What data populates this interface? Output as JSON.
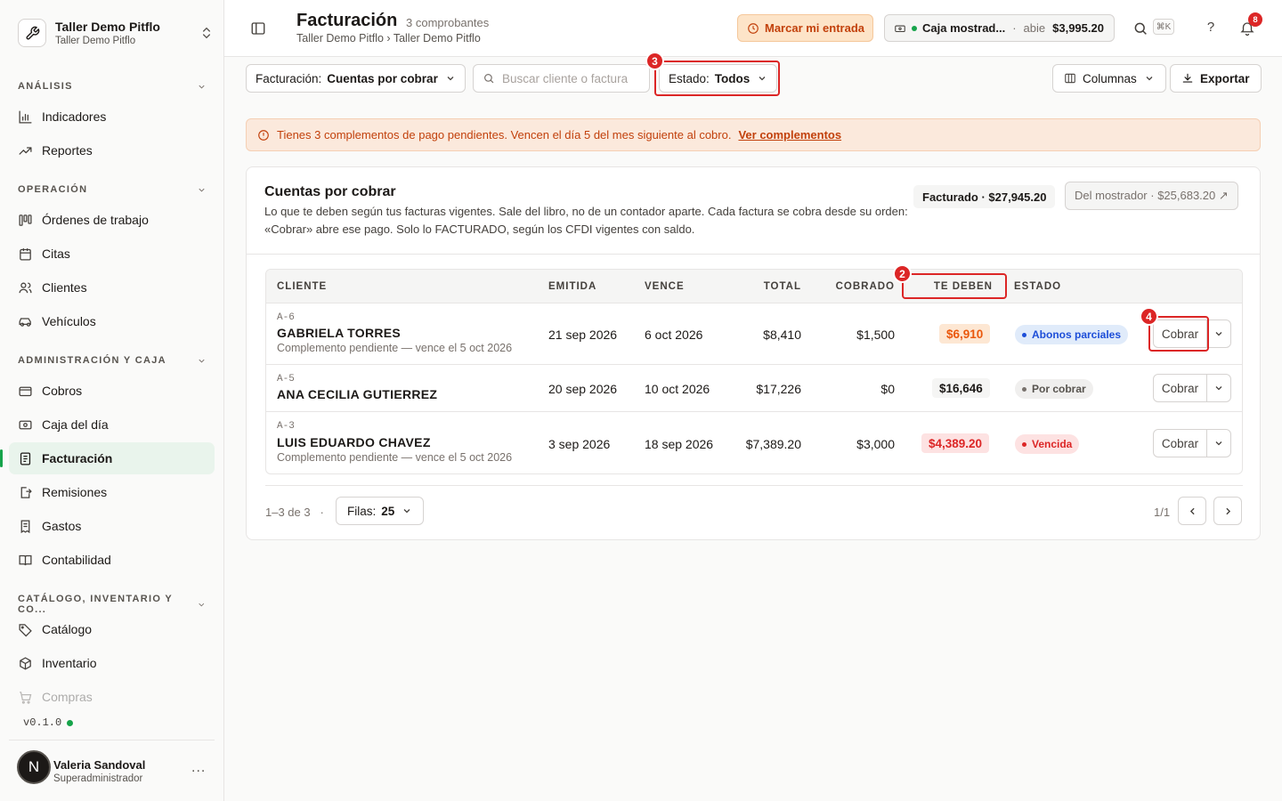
{
  "workspace": {
    "name": "Taller Demo Pitflo",
    "sub": "Taller Demo Pitflo"
  },
  "sidebar": {
    "sections": [
      {
        "label": "ANÁLISIS"
      },
      {
        "label": "OPERACIÓN"
      },
      {
        "label": "ADMINISTRACIÓN Y CAJA"
      },
      {
        "label": "CATÁLOGO, INVENTARIO Y CO..."
      }
    ],
    "items": [
      {
        "label": "Indicadores",
        "icon": "bar-chart-icon"
      },
      {
        "label": "Reportes",
        "icon": "trending-up-icon"
      },
      {
        "label": "Órdenes de trabajo",
        "icon": "kanban-icon"
      },
      {
        "label": "Citas",
        "icon": "calendar-icon"
      },
      {
        "label": "Clientes",
        "icon": "users-icon"
      },
      {
        "label": "Vehículos",
        "icon": "car-icon"
      },
      {
        "label": "Cobros",
        "icon": "credit-card-icon"
      },
      {
        "label": "Caja del día",
        "icon": "cash-icon"
      },
      {
        "label": "Facturación",
        "icon": "invoice-icon"
      },
      {
        "label": "Remisiones",
        "icon": "file-export-icon"
      },
      {
        "label": "Gastos",
        "icon": "receipt-icon"
      },
      {
        "label": "Contabilidad",
        "icon": "book-icon"
      },
      {
        "label": "Catálogo",
        "icon": "tag-icon"
      },
      {
        "label": "Inventario",
        "icon": "box-icon"
      },
      {
        "label": "Compras",
        "icon": "cart-icon"
      }
    ],
    "version": "v0.1.0",
    "user": {
      "initial": "N",
      "name": "Valeria Sandoval",
      "role": "Superadministrador",
      "more": "..."
    }
  },
  "header": {
    "title": "Facturación",
    "count": "3 comprobantes",
    "breadcrumb": "Taller Demo Pitflo › Taller Demo Pitflo",
    "marcar": "Marcar mi entrada",
    "caja": {
      "name": "Caja mostrad...",
      "sep": "·",
      "status": "abie",
      "amount": "$3,995.20"
    },
    "kbd": "⌘K",
    "help": "?",
    "notifications": "8"
  },
  "toolbar": {
    "facturacion_label": "Facturación:",
    "facturacion_value": "Cuentas por cobrar",
    "search_placeholder": "Buscar cliente o factura",
    "estado_label": "Estado:",
    "estado_value": "Todos",
    "columnas": "Columnas",
    "exportar": "Exportar"
  },
  "markers": [
    "2",
    "3",
    "4"
  ],
  "alert": {
    "text": "Tienes 3 complementos de pago pendientes. Vencen el día 5 del mes siguiente al cobro.",
    "link": "Ver complementos"
  },
  "card": {
    "title": "Cuentas por cobrar",
    "description": "Lo que te deben según tus facturas vigentes. Sale del libro, no de un contador aparte. Cada factura se cobra desde su orden: «Cobrar» abre ese pago. Solo lo FACTURADO, según los CFDI vigentes con saldo.",
    "facturado": "Facturado · $27,945.20",
    "mostrador": "Del mostrador · $25,683.20 ↗"
  },
  "table": {
    "headers": {
      "cliente": "CLIENTE",
      "emitida": "EMITIDA",
      "vence": "VENCE",
      "total": "TOTAL",
      "cobrado": "COBRADO",
      "tedeben": "TE DEBEN",
      "estado": "ESTADO"
    },
    "action_label": "Cobrar",
    "rows": [
      {
        "folio": "A-6",
        "cliente": "GABRIELA TORRES",
        "nota": "Complemento pendiente — vence el 5 oct 2026",
        "emitida": "21 sep 2026",
        "vence": "6 oct 2026",
        "total": "$8,410",
        "cobrado": "$1,500",
        "tedeben": "$6,910",
        "estado": "Abonos parciales"
      },
      {
        "folio": "A-5",
        "cliente": "ANA CECILIA GUTIERREZ",
        "nota": "",
        "emitida": "20 sep 2026",
        "vence": "10 oct 2026",
        "total": "$17,226",
        "cobrado": "$0",
        "tedeben": "$16,646",
        "estado": "Por cobrar"
      },
      {
        "folio": "A-3",
        "cliente": "LUIS EDUARDO CHAVEZ",
        "nota": "Complemento pendiente — vence el 5 oct 2026",
        "emitida": "3 sep 2026",
        "vence": "18 sep 2026",
        "total": "$7,389.20",
        "cobrado": "$3,000",
        "tedeben": "$4,389.20",
        "estado": "Vencida"
      }
    ]
  },
  "pagination": {
    "range": "1–3 de 3",
    "sep": "·",
    "filas_label": "Filas:",
    "filas_value": "25",
    "page": "1/1"
  },
  "colors": {
    "accent": "#16a34a",
    "danger": "#dc2626",
    "warning": "#c2410c",
    "info": "#1d4ed8"
  }
}
